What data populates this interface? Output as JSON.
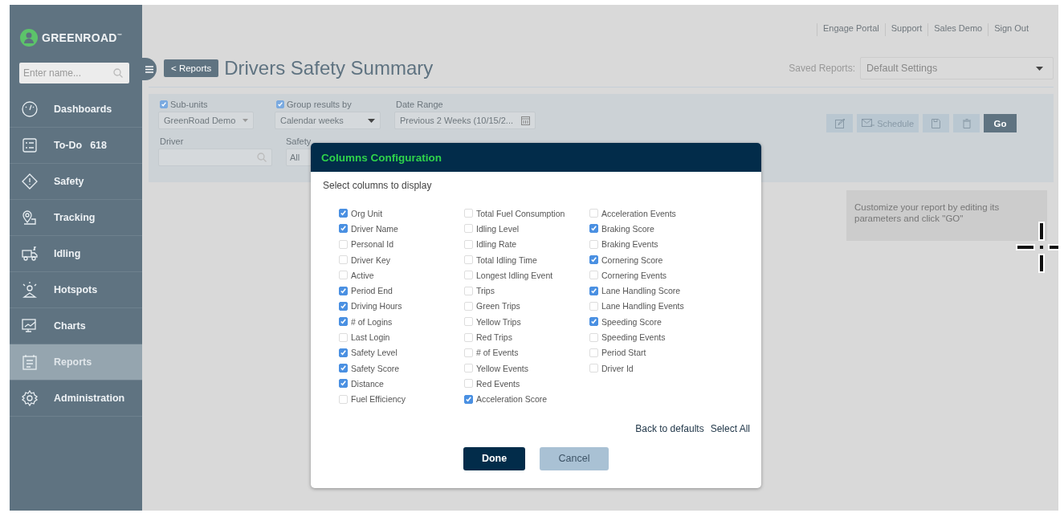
{
  "logo": {
    "text": "GREENROAD",
    "mark": "™"
  },
  "search": {
    "placeholder": "Enter name..."
  },
  "sidebar": {
    "items": [
      {
        "label": "Dashboards",
        "selected": false
      },
      {
        "label": "To-Do",
        "count": "618",
        "selected": false
      },
      {
        "label": "Safety",
        "selected": false
      },
      {
        "label": "Tracking",
        "selected": false
      },
      {
        "label": "Idling",
        "selected": false
      },
      {
        "label": "Hotspots",
        "selected": false
      },
      {
        "label": "Charts",
        "selected": false
      },
      {
        "label": "Reports",
        "selected": true
      },
      {
        "label": "Administration",
        "selected": false
      }
    ]
  },
  "top_links": [
    "Engage Portal",
    "Support",
    "Sales Demo",
    "Sign Out"
  ],
  "back_button": "< Reports",
  "page_title": "Drivers Safety Summary",
  "saved_reports": {
    "label": "Saved Reports:",
    "value": "Default Settings"
  },
  "filters": {
    "sub_units": {
      "label": "Sub-units",
      "checked": true,
      "value": "GreenRoad Demo"
    },
    "group_results": {
      "label": "Group results by",
      "checked": true,
      "value": "Calendar weeks"
    },
    "date_range": {
      "label": "Date Range",
      "value": "Previous 2 Weeks (10/15/2..."
    },
    "driver": {
      "label": "Driver"
    },
    "safety": {
      "label": "Safety",
      "value": "All"
    }
  },
  "toolbar": {
    "schedule": "Schedule",
    "go": "Go"
  },
  "tooltip": "Customize your report by editing its parameters and click \"GO\"",
  "dialog": {
    "title": "Columns Configuration",
    "subtitle": "Select columns to display",
    "columns": [
      [
        {
          "label": "Org Unit",
          "checked": true
        },
        {
          "label": "Driver Name",
          "checked": true
        },
        {
          "label": "Personal Id",
          "checked": false
        },
        {
          "label": "Driver Key",
          "checked": false
        },
        {
          "label": "Active",
          "checked": false
        },
        {
          "label": "Period End",
          "checked": true
        },
        {
          "label": "Driving Hours",
          "checked": true
        },
        {
          "label": "# of Logins",
          "checked": true
        },
        {
          "label": "Last Login",
          "checked": false
        },
        {
          "label": "Safety Level",
          "checked": true
        },
        {
          "label": "Safety Score",
          "checked": true
        },
        {
          "label": "Distance",
          "checked": true
        },
        {
          "label": "Fuel Efficiency",
          "checked": false
        }
      ],
      [
        {
          "label": "Total Fuel Consumption",
          "checked": false
        },
        {
          "label": "Idling Level",
          "checked": false
        },
        {
          "label": "Idling Rate",
          "checked": false
        },
        {
          "label": "Total Idling Time",
          "checked": false
        },
        {
          "label": "Longest Idling Event",
          "checked": false
        },
        {
          "label": "Trips",
          "checked": false
        },
        {
          "label": "Green Trips",
          "checked": false
        },
        {
          "label": "Yellow Trips",
          "checked": false
        },
        {
          "label": "Red Trips",
          "checked": false
        },
        {
          "label": "# of Events",
          "checked": false
        },
        {
          "label": "Yellow Events",
          "checked": false
        },
        {
          "label": "Red Events",
          "checked": false
        },
        {
          "label": "Acceleration Score",
          "checked": true
        }
      ],
      [
        {
          "label": "Acceleration Events",
          "checked": false
        },
        {
          "label": "Braking Score",
          "checked": true
        },
        {
          "label": "Braking Events",
          "checked": false
        },
        {
          "label": "Cornering Score",
          "checked": true
        },
        {
          "label": "Cornering Events",
          "checked": false
        },
        {
          "label": "Lane Handling Score",
          "checked": true
        },
        {
          "label": "Lane Handling Events",
          "checked": false
        },
        {
          "label": "Speeding Score",
          "checked": true
        },
        {
          "label": "Speeding Events",
          "checked": false
        },
        {
          "label": "Period Start",
          "checked": false
        },
        {
          "label": "Driver Id",
          "checked": false
        }
      ]
    ],
    "links": [
      "Back to defaults",
      "Select All"
    ],
    "buttons": [
      {
        "label": "Done",
        "kind": "primary"
      },
      {
        "label": "Cancel",
        "kind": "secondary"
      }
    ]
  }
}
